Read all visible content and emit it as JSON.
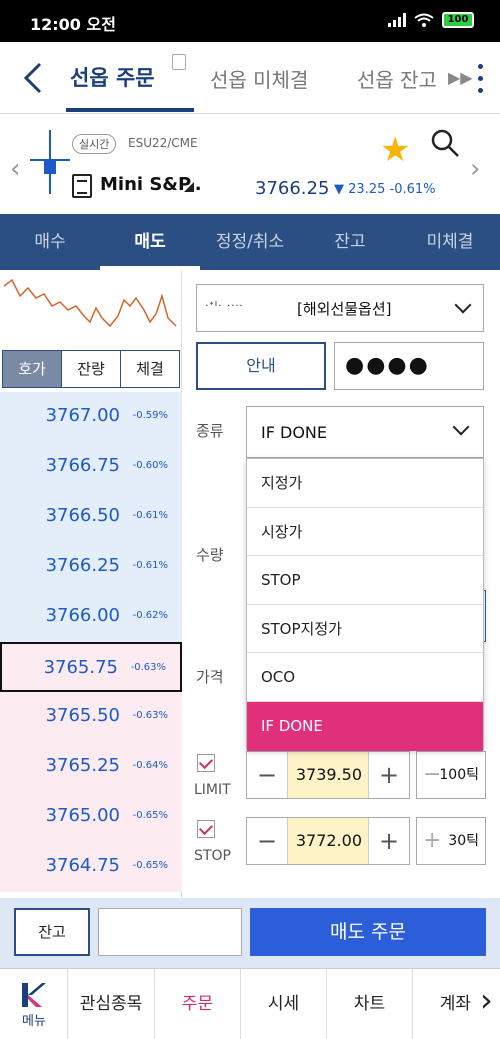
{
  "status_bar": {
    "time": "12:00 오전",
    "battery": "100"
  },
  "header": {
    "tabs": [
      {
        "label": "선옵 주문"
      },
      {
        "label": "선옵 미체결"
      },
      {
        "label": "선옵 잔고"
      }
    ]
  },
  "instrument": {
    "realtime_badge": "실시간",
    "code": "ESU22/CME",
    "name": "Mini S&P..",
    "price": "3766.25",
    "change": "23.25",
    "change_pct": "-0.61%",
    "colors": {
      "price": "#1b3f7a",
      "change": "#1b5ac7",
      "star": "#f7b500"
    }
  },
  "order_tabs": [
    {
      "label": "매수"
    },
    {
      "label": "매도"
    },
    {
      "label": "정정/취소"
    },
    {
      "label": "잔고"
    },
    {
      "label": "미체결"
    }
  ],
  "sub_tabs": [
    {
      "label": "호가"
    },
    {
      "label": "잔량"
    },
    {
      "label": "체결"
    }
  ],
  "quotes": [
    {
      "price": "3767.00",
      "pct": "-0.59%"
    },
    {
      "price": "3766.75",
      "pct": "-0.60%"
    },
    {
      "price": "3766.50",
      "pct": "-0.61%"
    },
    {
      "price": "3766.25",
      "pct": "-0.61%"
    },
    {
      "price": "3766.00",
      "pct": "-0.62%"
    },
    {
      "price": "3765.75",
      "pct": "-0.63%"
    },
    {
      "price": "3765.50",
      "pct": "-0.63%"
    },
    {
      "price": "3765.25",
      "pct": "-0.64%"
    },
    {
      "price": "3765.00",
      "pct": "-0.65%"
    },
    {
      "price": "3764.75",
      "pct": "-0.65%"
    }
  ],
  "form": {
    "account_masked": "ᐧᐩᑊᐧ ᐧᐧᐧᐧ",
    "account_label": "[해외선물옵션]",
    "guide_label": "안내",
    "password_masked": "●●●●",
    "type_label": "종류",
    "type_value": "IF DONE",
    "qty_label": "수량",
    "price_label": "가격",
    "type_options": [
      {
        "label": "지정가"
      },
      {
        "label": "시장가"
      },
      {
        "label": "STOP"
      },
      {
        "label": "STOP지정가"
      },
      {
        "label": "OCO"
      },
      {
        "label": "IF DONE"
      }
    ],
    "limit": {
      "label": "LIMIT",
      "value": "3739.50",
      "ticks": "100틱"
    },
    "stop": {
      "label": "STOP",
      "value": "3772.00",
      "ticks": "30틱"
    }
  },
  "actions": {
    "balance_label": "잔고",
    "sell_order_label": "매도 주문"
  },
  "bottom_nav": {
    "menu_label": "메뉴",
    "items": [
      {
        "label": "관심종목"
      },
      {
        "label": "주문"
      },
      {
        "label": "시세"
      },
      {
        "label": "차트"
      },
      {
        "label": "계좌"
      }
    ]
  }
}
